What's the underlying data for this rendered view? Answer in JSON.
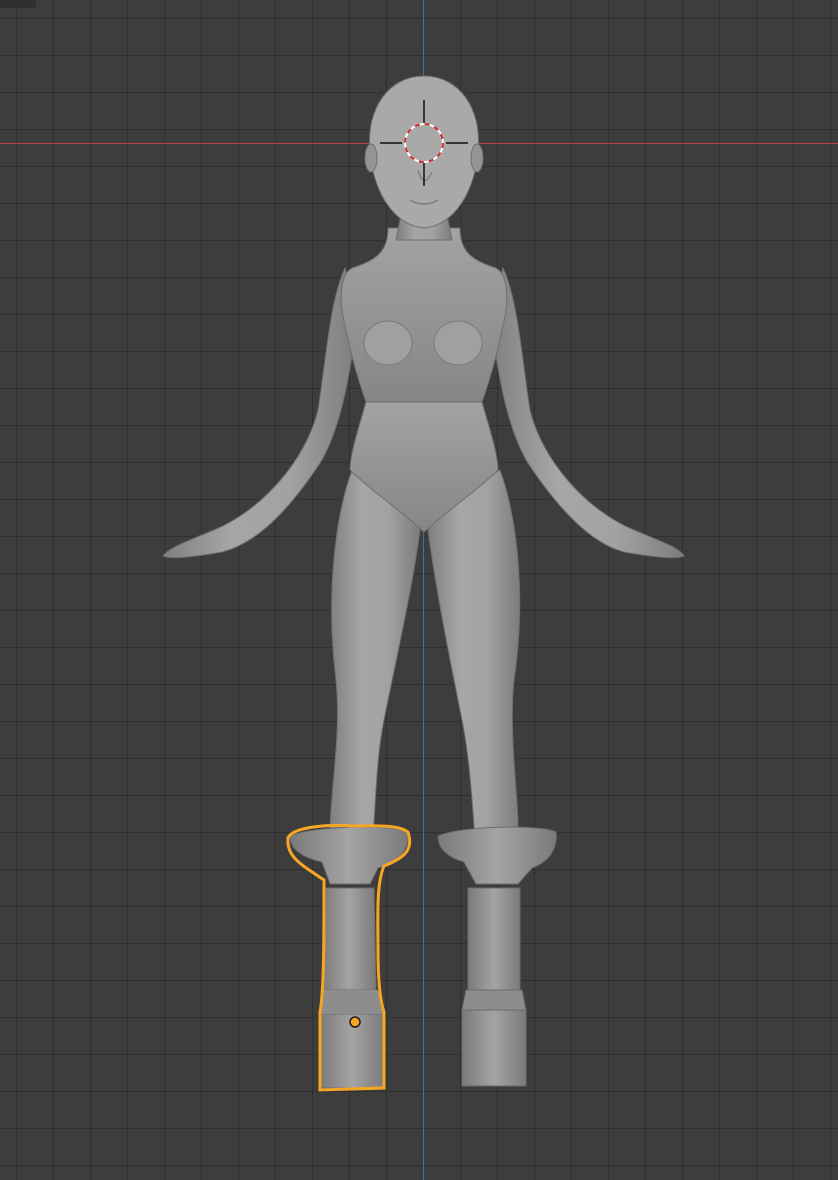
{
  "viewport": {
    "background": "#3d3d3d",
    "grid_line_color": "#2f2f2f"
  },
  "axes": {
    "x_axis_color": "#b5424e",
    "y_axis_color": "#3f6ea8"
  },
  "scene": {
    "figure_color": "#9a9a9a",
    "selected_object": "left-boot",
    "selection_outline_color": "#f5a623",
    "cursor_3d_icon": "3d-cursor-icon",
    "origin_icon": "object-origin-icon"
  }
}
